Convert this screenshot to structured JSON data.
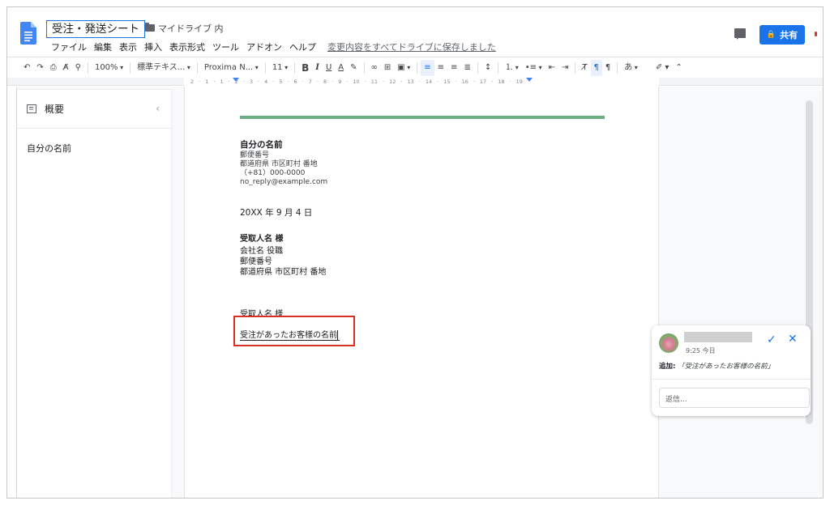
{
  "doc": {
    "title": "受注・発送シート",
    "drive_label": "マイドライブ 内"
  },
  "menu": {
    "items": [
      "ファイル",
      "編集",
      "表示",
      "挿入",
      "表示形式",
      "ツール",
      "アドオン",
      "ヘルプ"
    ],
    "save_status": "変更内容をすべてドライブに保存しました"
  },
  "share": {
    "label": "共有"
  },
  "toolbar": {
    "zoom": "100%",
    "style": "標準テキス...",
    "font": "Proxima N...",
    "font_size": "11",
    "bold": "B",
    "italic": "I",
    "underline": "U",
    "text_color": "A",
    "input_tool": "あ"
  },
  "ruler": {
    "labels": [
      "2",
      "1",
      "1",
      "2",
      "3",
      "4",
      "5",
      "6",
      "7",
      "8",
      "9",
      "10",
      "11",
      "12",
      "13",
      "14",
      "15",
      "16",
      "17",
      "18",
      "19"
    ]
  },
  "outline": {
    "title": "概要",
    "items": [
      "自分の名前"
    ]
  },
  "document": {
    "sender_name": "自分の名前",
    "sender_lines": [
      "郵便番号",
      "都道府県 市区町村 番地",
      "（+81）000-0000",
      "no_reply@example.com"
    ],
    "date": "20XX 年 9 月 4 日",
    "recipient_name": "受取人名 様",
    "recipient_lines": [
      "会社名 役職",
      "郵便番号",
      "都道府県 市区町村 番地"
    ],
    "salutation": "受取人名 様",
    "selected_text": "受注があったお客様の名前"
  },
  "comment": {
    "time": "9:25 今日",
    "action_label": "追加:",
    "quoted": "「受注があったお客様の名前」",
    "reply_placeholder": "返信..."
  },
  "colors": {
    "accent": "#1a73e8",
    "highlight_box": "#d93025",
    "rule_green": "#6aae82"
  }
}
